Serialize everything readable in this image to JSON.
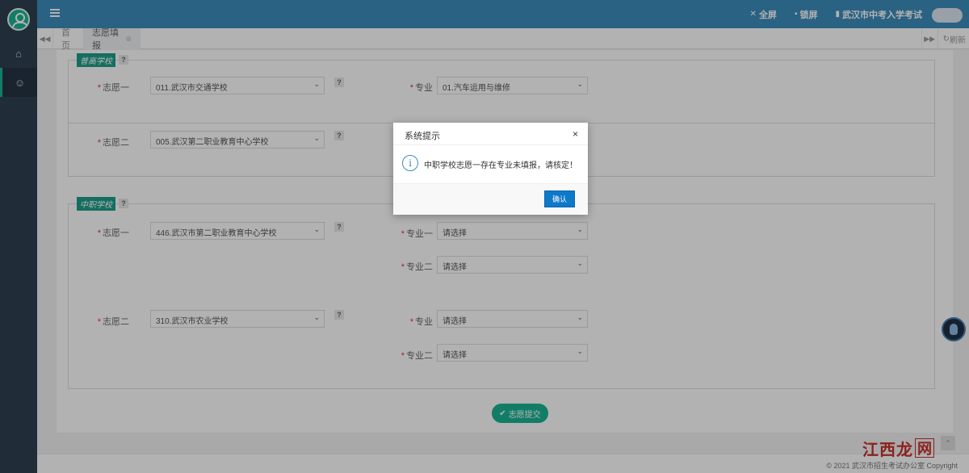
{
  "header": {
    "fullscreen": "全屏",
    "lock": "锁屏",
    "exam_name": "武汉市中考入学考试"
  },
  "tabs": {
    "home": "首页",
    "current": "志愿填报",
    "refresh": "刷新"
  },
  "section1": {
    "tag": "普高学校",
    "help": "?",
    "rows": [
      {
        "label": "志愿一",
        "school": "011.武汉市交通学校",
        "major_label": "专业",
        "major": "01.汽车运用与维修"
      },
      {
        "label": "志愿二",
        "school": "005.武汉第二职业教育中心学校",
        "major_label": "专业",
        "major": ""
      }
    ]
  },
  "section2": {
    "tag": "中职学校",
    "help": "?",
    "rows": [
      {
        "label": "志愿一",
        "school": "446.武汉市第二职业教育中心学校",
        "major1_label": "专业一",
        "major1": "请选择",
        "major2_label": "专业二",
        "major2": "请选择"
      },
      {
        "label": "志愿二",
        "school": "310.武汉市农业学校",
        "major1_label": "专业",
        "major1": "请选择",
        "major2_label": "专业二",
        "major2": "请选择"
      }
    ]
  },
  "submit_label": "志愿提交",
  "footer": "© 2021 武汉市招生考试办公室 Copyright",
  "watermark": {
    "text": "江西龙",
    "box": "网"
  },
  "modal": {
    "title": "系统提示",
    "close": "×",
    "info_glyph": "i",
    "message": "中职学校志愿一存在专业未填报，请核定！",
    "ok": "确认"
  },
  "colors": {
    "sidebar": "#2f4050",
    "topbar": "#3c8dbc",
    "accent": "#1ab394",
    "ok_button": "#0e78c9"
  },
  "icons": {
    "home": "home-icon",
    "user": "user-icon"
  }
}
